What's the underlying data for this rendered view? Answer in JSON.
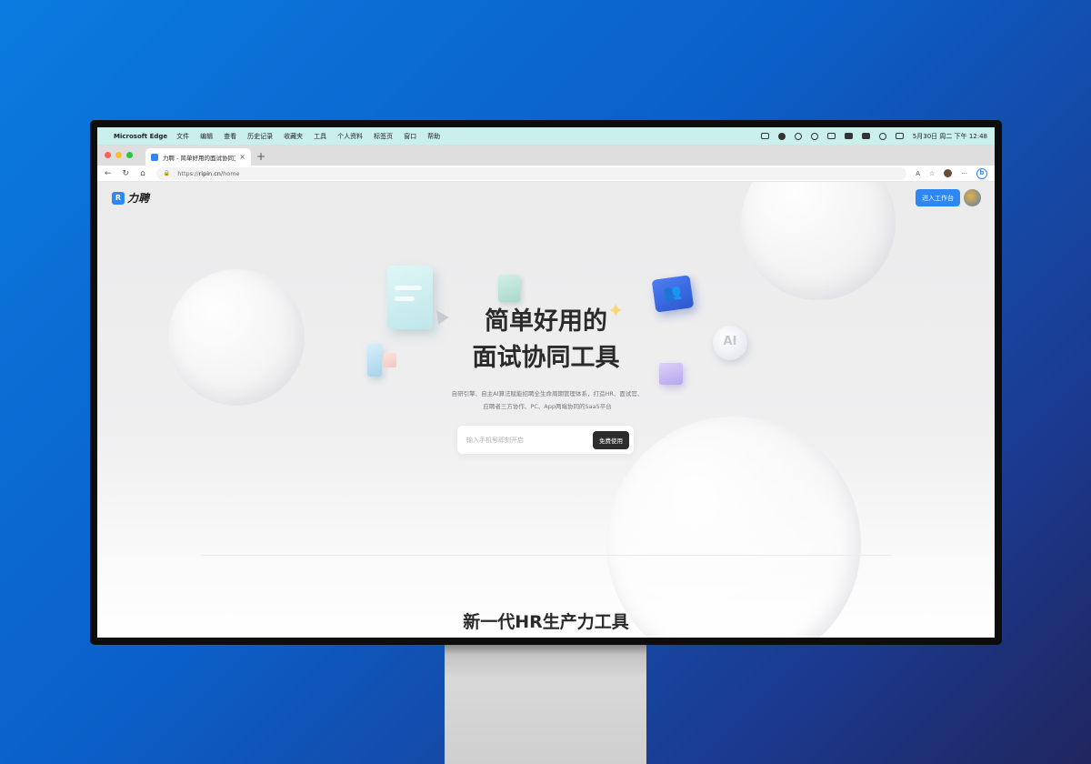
{
  "menubar": {
    "app_name": "Microsoft Edge",
    "items": [
      "文件",
      "编辑",
      "查看",
      "历史记录",
      "收藏夹",
      "工具",
      "个人资料",
      "标签页",
      "窗口",
      "帮助"
    ],
    "datetime": "5月30日 周二  下午 12:48"
  },
  "tab": {
    "title": "力聘 - 简单好用的面试协同工具"
  },
  "addressbar": {
    "url_prefix": "https://",
    "url_host": "ripin.cn",
    "url_path": "/home"
  },
  "page": {
    "logo_text": "力聘",
    "logo_mark": "R",
    "enter_button": "进入工作台",
    "hero_title_line1": "简单好用的",
    "hero_title_line2": "面试协同工具",
    "hero_desc": "自研引擎、自主AI算法赋能招聘全生命周期管理体系，打造HR、面试官、应聘者三方协作、PC、App两端协同的SaaS平台",
    "phone_placeholder": "输入手机号即刻开启",
    "free_button": "免费使用",
    "section_title": "新一代HR生产力工具",
    "ai_label": "AI"
  },
  "colors": {
    "accent": "#2f86f5",
    "menubar_bg": "#c9f0ec",
    "dark_button": "#2d2d2d"
  }
}
